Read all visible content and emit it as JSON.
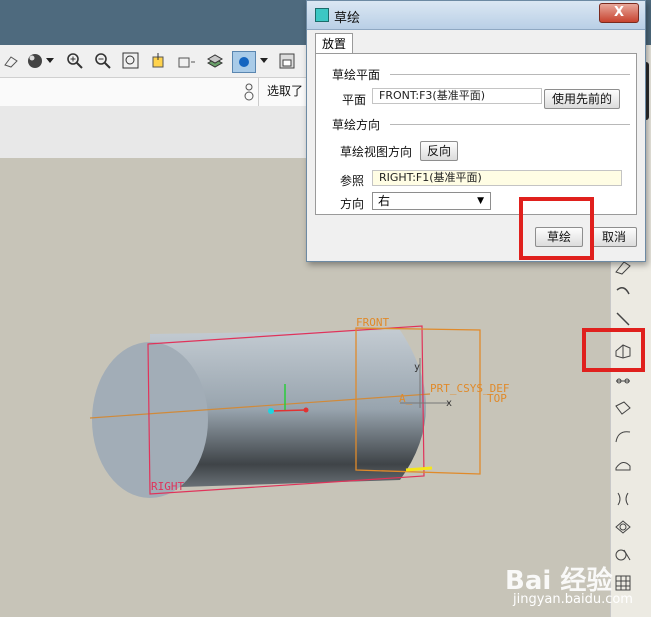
{
  "toolbar": {
    "selected_label": "选取了"
  },
  "dialog": {
    "title": "草绘",
    "close_label": "X",
    "tab_label": "放置",
    "sketch_plane": {
      "section_label": "草绘平面",
      "plane_label": "平面",
      "plane_value": "FRONT:F3(基准平面)",
      "use_previous_label": "使用先前的"
    },
    "sketch_orientation": {
      "section_label": "草绘方向",
      "view_direction_label": "草绘视图方向",
      "flip_label": "反向",
      "reference_label": "参照",
      "reference_value": "RIGHT:F1(基准平面)",
      "orientation_label": "方向",
      "orientation_value": "右"
    },
    "sketch_button": "草绘",
    "cancel_button": "取消"
  },
  "model": {
    "datum_front": "FRONT",
    "datum_right": "RIGHT",
    "csys_label": "PRT_CSYS_DEF",
    "axis_a": "A_",
    "axis_top": "TOP",
    "axis_x": "x",
    "axis_y": "y"
  },
  "watermark": {
    "brand": "Bai 经验",
    "url": "jingyan.baidu.com"
  },
  "colors": {
    "highlight_red": "#e0201d",
    "datum_orange": "#e08a2a",
    "datum_red": "#e0335a",
    "cylinder": "#9aa6b0"
  }
}
